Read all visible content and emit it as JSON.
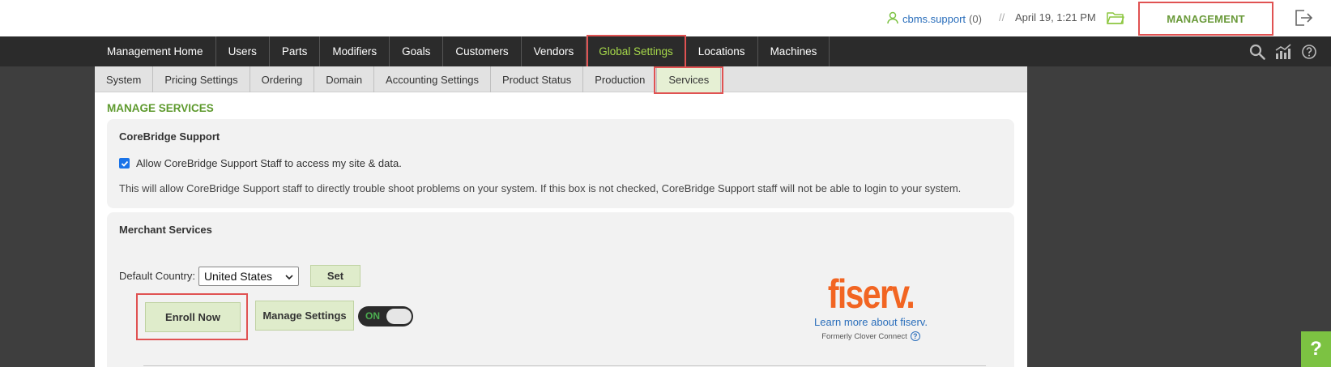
{
  "topbar": {
    "username": "cbms.support",
    "user_count": "(0)",
    "separator": "//",
    "datetime": "April 19, 1:21 PM",
    "management_label": "MANAGEMENT"
  },
  "main_nav": {
    "items": [
      {
        "label": "Management Home"
      },
      {
        "label": "Users"
      },
      {
        "label": "Parts"
      },
      {
        "label": "Modifiers"
      },
      {
        "label": "Goals"
      },
      {
        "label": "Customers"
      },
      {
        "label": "Vendors"
      },
      {
        "label": "Global Settings"
      },
      {
        "label": "Locations"
      },
      {
        "label": "Machines"
      }
    ],
    "active": "Global Settings"
  },
  "sub_nav": {
    "items": [
      {
        "label": "System"
      },
      {
        "label": "Pricing Settings"
      },
      {
        "label": "Ordering"
      },
      {
        "label": "Domain"
      },
      {
        "label": "Accounting Settings"
      },
      {
        "label": "Product Status"
      },
      {
        "label": "Production"
      },
      {
        "label": "Services"
      }
    ],
    "active": "Services"
  },
  "page": {
    "title": "MANAGE SERVICES"
  },
  "support_card": {
    "title": "CoreBridge Support",
    "checkbox_label": "Allow CoreBridge Support Staff to access my site & data.",
    "checked": true,
    "description": "This will allow CoreBridge Support staff to directly trouble shoot problems on your system. If this box is not checked, CoreBridge Support staff will not be able to login to your system."
  },
  "merchant_card": {
    "title": "Merchant Services",
    "country_label": "Default Country:",
    "country_value": "United States",
    "set_label": "Set",
    "enroll_label": "Enroll Now",
    "manage_label": "Manage Settings",
    "toggle_label": "ON",
    "fiserv_logo": "fiserv.",
    "fiserv_link": "Learn more about fiserv.",
    "fiserv_note": "Formerly Clover Connect"
  },
  "colors": {
    "accent_green": "#5e9a2e",
    "nav_active": "#a6d84a",
    "highlight_red": "#e05252",
    "fiserv_orange": "#f26522",
    "link_blue": "#2a6ebb"
  },
  "icons": {
    "user": "user-icon",
    "folder": "folder-icon",
    "logout": "logout-icon",
    "search": "search-icon",
    "chart": "chart-icon",
    "help": "help-icon"
  }
}
